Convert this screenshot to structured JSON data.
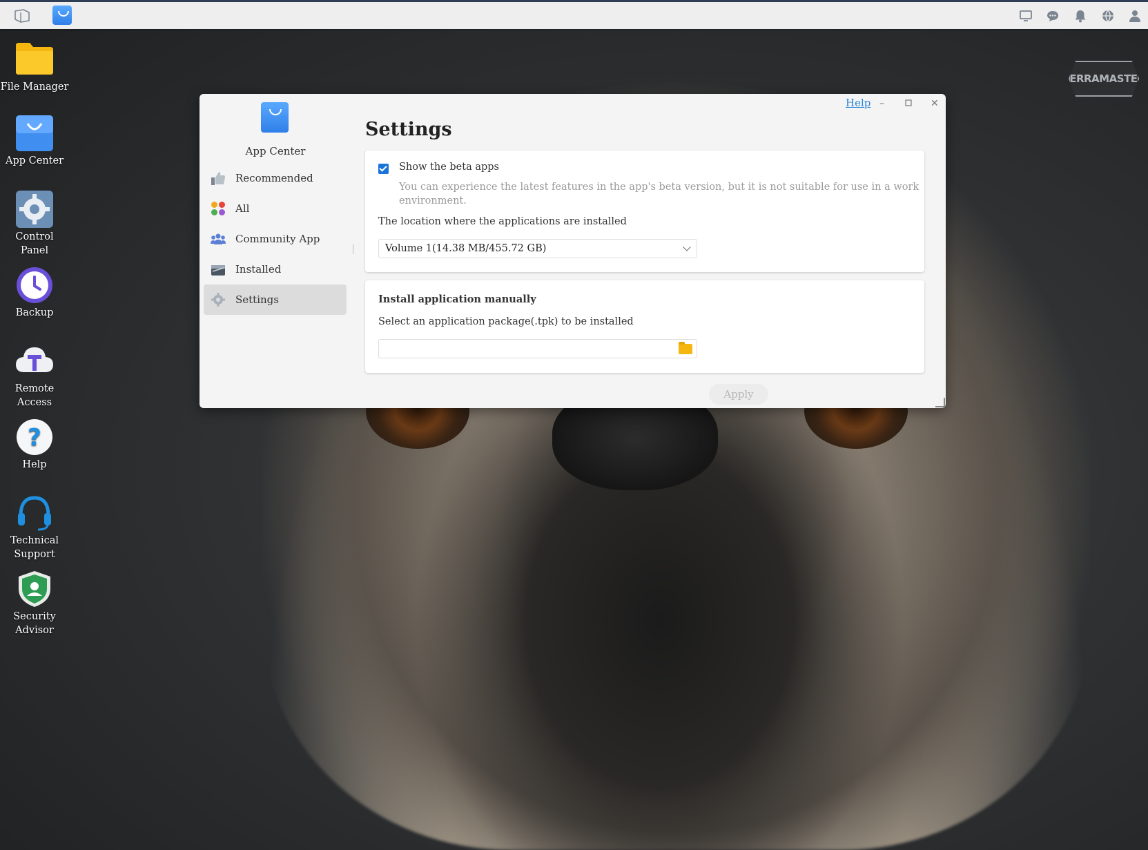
{
  "taskbar": {
    "right_icons": [
      "monitor-icon",
      "chat-icon",
      "bell-icon",
      "globe-icon",
      "user-icon"
    ]
  },
  "desktop": {
    "icons": [
      {
        "label": "File Manager",
        "icon": "folder-icon"
      },
      {
        "label": "App Center",
        "icon": "shopping-bag-icon"
      },
      {
        "label": "Control Panel",
        "icon": "gear-icon"
      },
      {
        "label": "Backup",
        "icon": "clock-icon"
      },
      {
        "label": "Remote Access",
        "icon": "cloud-t-icon"
      },
      {
        "label": "Help",
        "icon": "question-icon"
      },
      {
        "label": "Technical Support",
        "label_line1": "Technical",
        "label_line2": "Support",
        "icon": "headset-icon"
      },
      {
        "label": "Security Advisor",
        "label_line1": "Security",
        "label_line2": "Advisor",
        "icon": "shield-icon"
      }
    ],
    "brand_logo": "TERRAMASTER"
  },
  "window": {
    "help_label": "Help",
    "app_name": "App Center",
    "nav": [
      {
        "label": "Recommended",
        "icon": "thumbs-up-icon"
      },
      {
        "label": "All",
        "icon": "grid-icon"
      },
      {
        "label": "Community App",
        "icon": "community-icon"
      },
      {
        "label": "Installed",
        "icon": "installed-icon"
      },
      {
        "label": "Settings",
        "icon": "gear-icon",
        "active": true
      }
    ],
    "title": "Settings",
    "beta": {
      "checked": true,
      "label": "Show the beta apps",
      "desc_line1": "You can experience the latest features in the app's beta version, but it is not suitable for use in a work",
      "desc_line2": "environment."
    },
    "location_label": "The location where the applications are installed",
    "location_value": "Volume 1(14.38 MB/455.72 GB)",
    "manual_title": "Install application manually",
    "manual_desc": "Select an application package(.tpk) to be installed",
    "file_value": "",
    "apply_label": "Apply"
  },
  "colors": {
    "accent": "#1a73d9",
    "link": "#2a86d8",
    "folder": "#f5b70f"
  }
}
